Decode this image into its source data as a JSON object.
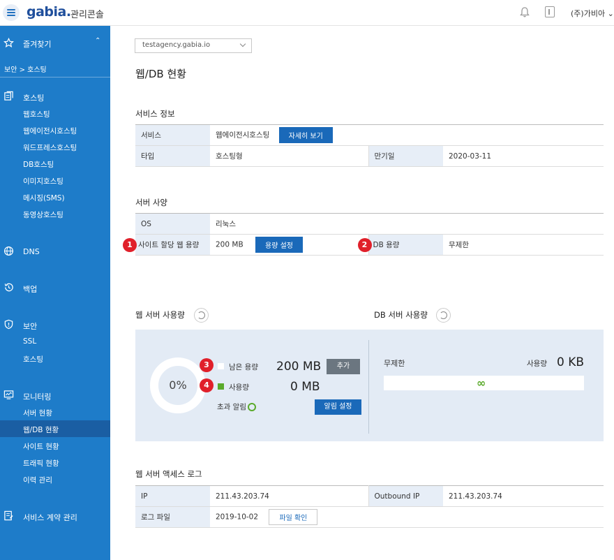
{
  "header": {
    "logo": "gabia.",
    "app_name": "관리콘솔",
    "user": "(주)가비아"
  },
  "sidebar": {
    "favorites": "즐겨찾기",
    "breadcrumb": "보안 > 호스팅",
    "hosting": {
      "label": "호스팅",
      "items": [
        "웹호스팅",
        "웹에이전시호스팅",
        "워드프레스호스팅",
        "DB호스팅",
        "이미지호스팅",
        "메시징(SMS)",
        "동영상호스팅"
      ]
    },
    "dns": "DNS",
    "backup": "백업",
    "security": {
      "label": "보안",
      "items": [
        "SSL",
        "호스팅"
      ]
    },
    "monitoring": {
      "label": "모니터링",
      "items": [
        "서버 현황",
        "웹/DB 현황",
        "사이트 현황",
        "트래픽 현황",
        "이력 관리"
      ],
      "active_index": 1
    },
    "contract": "서비스 계약 관리"
  },
  "domain_select": {
    "value": "testagency.gabia.io"
  },
  "page_title": "웹/DB 현황",
  "service_info": {
    "title": "서비스 정보",
    "service_label": "서비스",
    "service_value": "웹에이전시호스팅",
    "detail_button": "자세히 보기",
    "type_label": "타입",
    "type_value": "호스팅형",
    "expire_label": "만기일",
    "expire_value": "2020-03-11"
  },
  "server_spec": {
    "title": "서버 사양",
    "os_label": "OS",
    "os_value": "리눅스",
    "web_cap_label": "사이트 할당 웹 용량",
    "web_cap_value": "200 MB",
    "cap_button": "용량 설정",
    "db_cap_label": "DB 용량",
    "db_cap_value": "무제한",
    "badge1": "1",
    "badge2": "2"
  },
  "web_usage": {
    "title": "웹 서버 사용량",
    "percent": "0%",
    "percent_value": 0,
    "remaining_label": "남은 용량",
    "remaining_value": "200 MB",
    "add_button": "추가",
    "used_label": "사용량",
    "used_value": "0 MB",
    "alert_label": "초과 알림",
    "alert_button": "알림 설정",
    "badge3": "3",
    "badge4": "4"
  },
  "db_usage": {
    "title": "DB 서버 사용량",
    "limit": "무제한",
    "used_label": "사용량",
    "used_value": "0 KB"
  },
  "access_log": {
    "title": "웹 서버 액세스 로그",
    "ip_label": "IP",
    "ip_value": "211.43.203.74",
    "outbound_label": "Outbound IP",
    "outbound_value": "211.43.203.74",
    "logfile_label": "로그 파일",
    "logfile_value": "2019-10-02",
    "file_button": "파일 확인"
  },
  "colors": {
    "sidebar": "#1e7cc9",
    "primary_button": "#1a69b9",
    "table_header": "#e7eef7",
    "usage_panel": "#e3ebf5",
    "badge": "#e0202a",
    "used_green": "#5aaa2b"
  }
}
